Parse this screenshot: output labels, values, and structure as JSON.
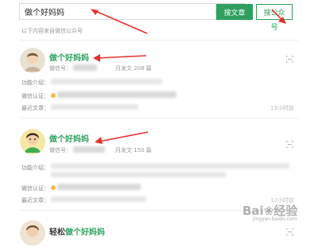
{
  "search": {
    "value": "做个好妈妈"
  },
  "buttons": {
    "search_articles": "搜文章",
    "search_accounts": "搜公众号"
  },
  "hint": "以下内容来自微信公众号",
  "results": [
    {
      "title": "做个好妈妈",
      "wechat_id_label": "微信号：",
      "monthly_label": "月发文 208 篇",
      "intro_label": "功能介绍：",
      "verified_label": "微信认证：",
      "recent_label": "最近文章：",
      "time": "13小时前"
    },
    {
      "title": "做个好妈妈",
      "wechat_id_label": "微信号：",
      "monthly_label": "月发文 150 篇",
      "intro_label": "功能介绍：",
      "verified_label": "微信认证：",
      "recent_label": "最近文章：",
      "time": "12小时前"
    },
    {
      "title_prefix": "轻松",
      "title": "做个好妈妈"
    }
  ],
  "watermark": {
    "main": "Bai❀经验",
    "sub": "jingyan.baidu.com"
  },
  "annotations": {
    "arrow_color": "#e8312f"
  },
  "colors": {
    "accent": "#2e9f5e"
  }
}
